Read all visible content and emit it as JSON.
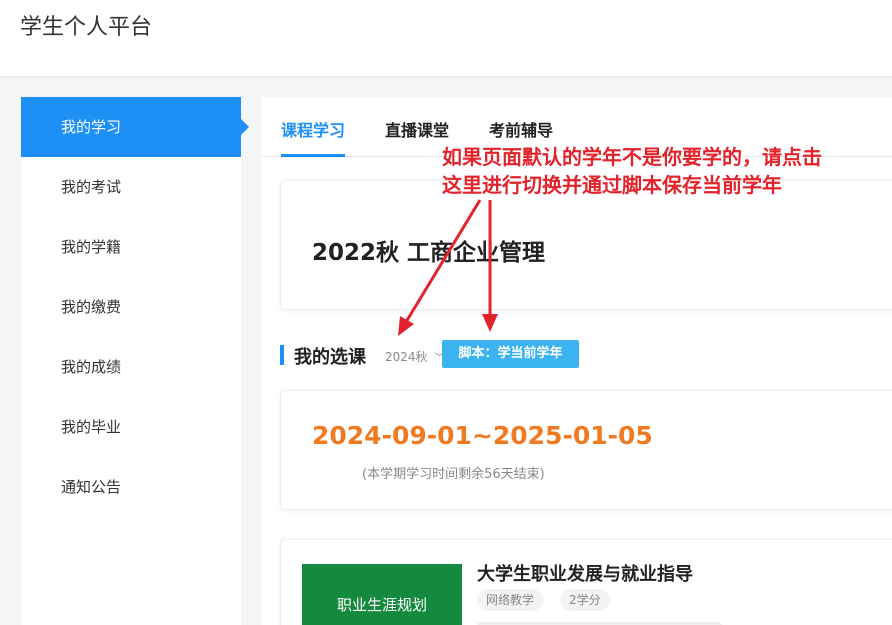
{
  "app": {
    "title": "学生个人平台"
  },
  "sidebar": {
    "items": [
      {
        "label": "我的学习",
        "active": true
      },
      {
        "label": "我的考试"
      },
      {
        "label": "我的学籍"
      },
      {
        "label": "我的缴费"
      },
      {
        "label": "我的成绩"
      },
      {
        "label": "我的毕业"
      },
      {
        "label": "通知公告"
      }
    ]
  },
  "tabs": [
    {
      "label": "课程学习",
      "active": true
    },
    {
      "label": "直播课堂"
    },
    {
      "label": "考前辅导"
    }
  ],
  "term": {
    "title": "2022秋 工商企业管理"
  },
  "section": {
    "title": "我的选课",
    "year_select": "2024秋",
    "script_button": "脚本：学当前学年"
  },
  "schedule": {
    "date_range": "2024-09-01~2025-01-05",
    "note": "(本学期学习时间剩余56天结束)"
  },
  "course": {
    "thumb_label": "职业生涯规划",
    "name": "大学生职业发展与就业指导",
    "tags": [
      "网络教学",
      "2学分"
    ]
  },
  "annotation": {
    "line1": "如果页面默认的学年不是你要学的，请点击",
    "line2": "这里进行切换并通过脚本保存当前学年",
    "color": "#e3232c"
  },
  "colors": {
    "accent": "#1d8ff5",
    "script_button": "#3ab3f0",
    "date": "#f07a22",
    "course_thumb": "#148a3f"
  }
}
